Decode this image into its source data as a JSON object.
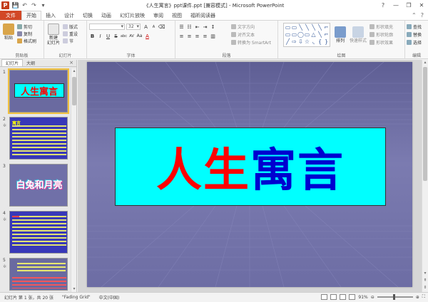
{
  "window": {
    "title": "《人生寓言》ppt课件.ppt [兼容模式] - Microsoft PowerPoint",
    "logo": "P",
    "minimize": "—",
    "restore": "❐",
    "close": "✕"
  },
  "qat": {
    "save_icon": "💾",
    "undo_icon": "↶",
    "redo_icon": "↷",
    "more_icon": "▾"
  },
  "tabs": [
    {
      "label": "文件"
    },
    {
      "label": "开始"
    },
    {
      "label": "插入"
    },
    {
      "label": "设计"
    },
    {
      "label": "切换"
    },
    {
      "label": "动画"
    },
    {
      "label": "幻灯片放映"
    },
    {
      "label": "审阅"
    },
    {
      "label": "视图"
    },
    {
      "label": "福昕阅读器"
    }
  ],
  "ribbon": {
    "clipboard": {
      "label": "剪贴板",
      "paste": "粘贴",
      "cut": "剪切",
      "copy": "复制",
      "format_painter": "格式刷"
    },
    "slides": {
      "label": "幻灯片",
      "new_slide": "新建\n幻灯片",
      "layout": "版式",
      "reset": "重设",
      "section": "节"
    },
    "font": {
      "label": "字体",
      "font_size": "32",
      "bold": "B",
      "italic": "I",
      "underline": "U",
      "strike": "S",
      "shadow": "abc",
      "spacing": "AV",
      "case": "Aa",
      "color": "A",
      "grow": "A",
      "shrink": "A"
    },
    "paragraph": {
      "label": "段落",
      "text_direction": "文字方向",
      "align_text": "对齐文本",
      "smartart": "转换为 SmartArt"
    },
    "drawing": {
      "label": "绘图",
      "arrange": "排列",
      "quick_styles": "快速样式",
      "shape_fill": "形状填充",
      "shape_outline": "形状轮廓",
      "shape_effects": "形状效果",
      "shapes": [
        "▭",
        "▭",
        "╲",
        "╲",
        "╲",
        "╲",
        "⌐",
        "▭",
        "▭",
        "◯",
        "▭",
        "△",
        "╲",
        "⌐",
        "╱",
        "⇨",
        "⇩",
        "☆",
        "◟",
        "{",
        "}"
      ]
    },
    "editing": {
      "label": "编辑",
      "find": "查找",
      "replace": "替换",
      "select": "选择"
    }
  },
  "left_panel": {
    "tab_slides": "幻灯片",
    "tab_outline": "大纲",
    "close": "×",
    "thumbnails": [
      {
        "num": "1",
        "title": "人生寓言"
      },
      {
        "num": "2",
        "title": "寓言"
      },
      {
        "num": "3",
        "title": "白兔和月亮"
      },
      {
        "num": "4",
        "title": ""
      },
      {
        "num": "5",
        "title": ""
      }
    ]
  },
  "slide": {
    "title_part1": "人生",
    "title_part2": "寓言"
  },
  "status": {
    "slide_info": "幻灯片 第 1 张，共 20 张",
    "theme": "\"Fading Grid\"",
    "language": "中文(中国)",
    "zoom": "91%",
    "zoom_minus": "⊖",
    "zoom_plus": "⊕"
  },
  "colors": {
    "file_tab": "#d24726",
    "slide_bg": "#6d6da4",
    "title_box": "#00ffff",
    "title_red": "#ff0000",
    "title_blue": "#0000d0"
  }
}
